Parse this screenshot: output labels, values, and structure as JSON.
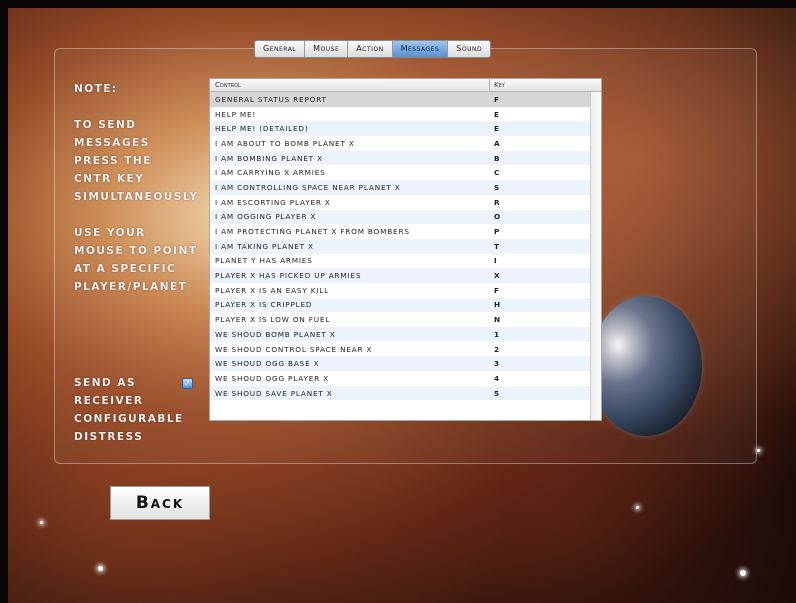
{
  "tabs": [
    {
      "label": "General",
      "active": false
    },
    {
      "label": "Mouse",
      "active": false
    },
    {
      "label": "Action",
      "active": false
    },
    {
      "label": "Messages",
      "active": true
    },
    {
      "label": "Sound",
      "active": false
    }
  ],
  "side": {
    "note_title": "Note:",
    "note_lines": [
      "To send",
      "messages",
      "press the",
      "CNTR key",
      "simultaneously"
    ],
    "mouse_lines": [
      "Use your",
      "mouse to point",
      "at a specific",
      "player/planet"
    ],
    "send_lines": [
      "Send as",
      "receiver",
      "configurable",
      "distress"
    ],
    "send_checked": true
  },
  "table": {
    "headers": {
      "control": "Control",
      "key": "Key"
    },
    "rows": [
      {
        "control": "General status report",
        "key": "F"
      },
      {
        "control": "Help me!",
        "key": "E"
      },
      {
        "control": "Help me! (detailed)",
        "key": "e"
      },
      {
        "control": "I am about to bomb planet x",
        "key": "A"
      },
      {
        "control": "I am bombing planet x",
        "key": "B"
      },
      {
        "control": "I am carrying x armies",
        "key": "c"
      },
      {
        "control": "I am controlling space near planet x",
        "key": "S"
      },
      {
        "control": "I am escorting player x",
        "key": "R"
      },
      {
        "control": "I am ogging player x",
        "key": "O"
      },
      {
        "control": "I am protecting planet x from bombers",
        "key": "P"
      },
      {
        "control": "I am taking planet x",
        "key": "T"
      },
      {
        "control": "Planet y has armies",
        "key": "I"
      },
      {
        "control": "Player x has picked up armies",
        "key": "X"
      },
      {
        "control": "Player x is an easy kill",
        "key": "F"
      },
      {
        "control": "Player x is crippled",
        "key": "H"
      },
      {
        "control": "Player x is low on fuel",
        "key": "N"
      },
      {
        "control": "We shoud bomb planet x",
        "key": "1"
      },
      {
        "control": "We shoud control space near x",
        "key": "2"
      },
      {
        "control": "We shoud ogg base x",
        "key": "3"
      },
      {
        "control": "We shoud ogg player x",
        "key": "4"
      },
      {
        "control": "We shoud save planet x",
        "key": "5"
      },
      {
        "control": "",
        "key": ""
      }
    ]
  },
  "back_label": "Back"
}
